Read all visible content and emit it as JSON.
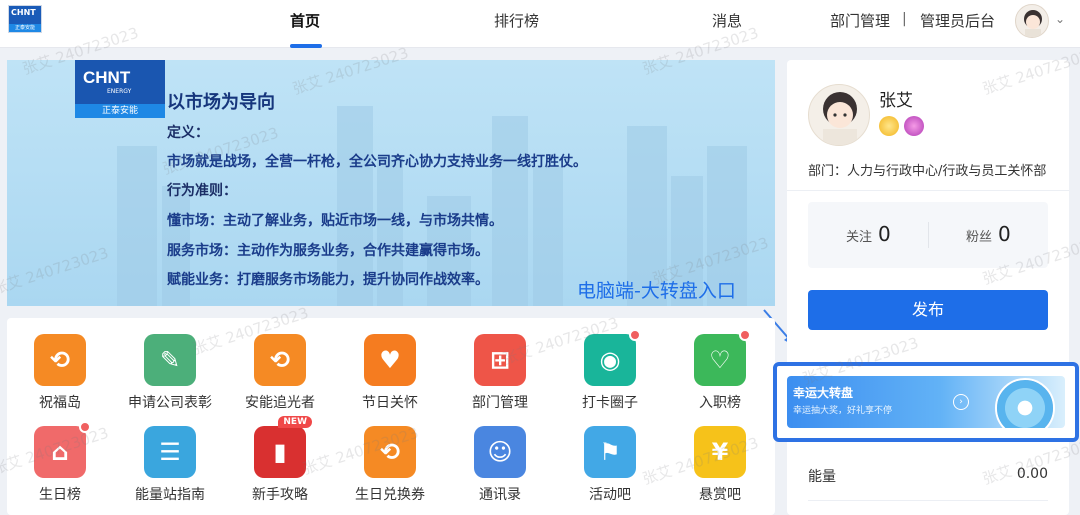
{
  "brand": {
    "logo_text": "CHNT",
    "logo_sub": "正泰安能",
    "banner_logo_text": "CHNT",
    "banner_logo_energy": "ENERGY",
    "banner_logo_sub": "正泰安能"
  },
  "nav": {
    "items": [
      {
        "label": "首页"
      },
      {
        "label": "排行榜"
      },
      {
        "label": "消息"
      }
    ],
    "dept_manage": "部门管理",
    "separator": "|",
    "admin": "管理员后台"
  },
  "banner": {
    "title": "以市场为导向",
    "definition_label": "定义：",
    "definition": "市场就是战场，全营一杆枪，全公司齐心协力支持业务一线打胜仗。",
    "criteria_label": "行为准则：",
    "line1": "懂市场：主动了解业务，贴近市场一线，与市场共情。",
    "line2": "服务市场：主动作为服务业务，合作共建赢得市场。",
    "line3": "赋能业务：打磨服务市场能力，提升协同作战效率。"
  },
  "annotation": "电脑端-大转盘入口",
  "apps": [
    {
      "label": "祝福岛",
      "color": "#f58a24",
      "glyph": "⟲",
      "icon": "blessing-island-icon"
    },
    {
      "label": "申请公司表彰",
      "color": "#4caf7a",
      "glyph": "✎",
      "icon": "commendation-icon"
    },
    {
      "label": "安能追光者",
      "color": "#f58a24",
      "glyph": "⟲",
      "icon": "light-chaser-icon"
    },
    {
      "label": "节日关怀",
      "color": "#f57c20",
      "glyph": "♥",
      "icon": "holiday-care-icon"
    },
    {
      "label": "部门管理",
      "color": "#ee5548",
      "glyph": "⊞",
      "icon": "org-chart-icon"
    },
    {
      "label": "打卡圈子",
      "color": "#19b59a",
      "glyph": "◉",
      "icon": "checkin-circle-icon",
      "dot": true
    },
    {
      "label": "入职榜",
      "color": "#3cb85a",
      "glyph": "♡",
      "icon": "onboarding-icon",
      "dot": true
    },
    {
      "label": "生日榜",
      "color": "#f06a6a",
      "glyph": "⌂",
      "icon": "birthday-cake-icon",
      "dot": true
    },
    {
      "label": "能量站指南",
      "color": "#3aa6de",
      "glyph": "☰",
      "icon": "guide-icon"
    },
    {
      "label": "新手攻略",
      "color": "#d93030",
      "glyph": "▮",
      "icon": "newbie-guide-icon",
      "badge": "NEW"
    },
    {
      "label": "生日兑换券",
      "color": "#f58a24",
      "glyph": "⟲",
      "icon": "birthday-coupon-icon"
    },
    {
      "label": "通讯录",
      "color": "#4a86e0",
      "glyph": "☺",
      "icon": "contacts-icon"
    },
    {
      "label": "活动吧",
      "color": "#42a8e6",
      "glyph": "⚑",
      "icon": "activity-flag-icon"
    },
    {
      "label": "悬赏吧",
      "color": "#f6c21a",
      "glyph": "¥",
      "icon": "reward-bag-icon"
    }
  ],
  "profile": {
    "name": "张艾",
    "dept": "部门：人力与行政中心/行政与员工关怀部",
    "follow_label": "关注",
    "follow_count": "0",
    "fans_label": "粉丝",
    "fans_count": "0",
    "publish": "发布"
  },
  "lucky_wheel": {
    "title": "幸运大转盘",
    "subtitle": "幸运抽大奖，好礼享不停"
  },
  "energy": {
    "label": "能量",
    "value": "0.00"
  },
  "watermark": "张艾 240723023"
}
